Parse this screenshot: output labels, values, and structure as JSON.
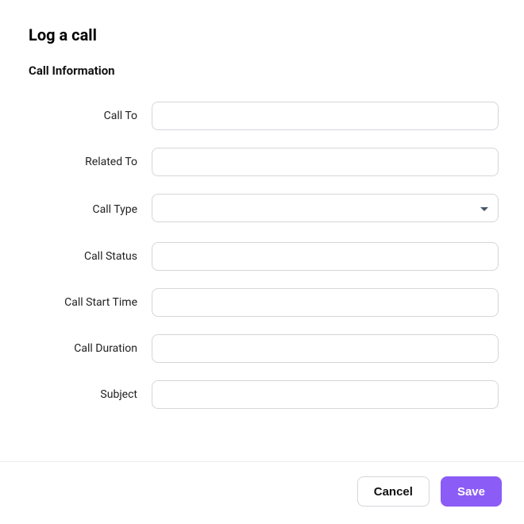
{
  "dialog": {
    "title": "Log a call",
    "section_title": "Call Information"
  },
  "fields": {
    "call_to": {
      "label": "Call To",
      "value": ""
    },
    "related_to": {
      "label": "Related To",
      "value": ""
    },
    "call_type": {
      "label": "Call Type",
      "value": ""
    },
    "call_status": {
      "label": "Call Status",
      "value": ""
    },
    "call_start_time": {
      "label": "Call Start Time",
      "value": ""
    },
    "call_duration": {
      "label": "Call Duration",
      "value": ""
    },
    "subject": {
      "label": "Subject",
      "value": ""
    }
  },
  "buttons": {
    "cancel": "Cancel",
    "save": "Save"
  },
  "colors": {
    "primary": "#8b5cf6",
    "border": "#d6d6dc"
  }
}
